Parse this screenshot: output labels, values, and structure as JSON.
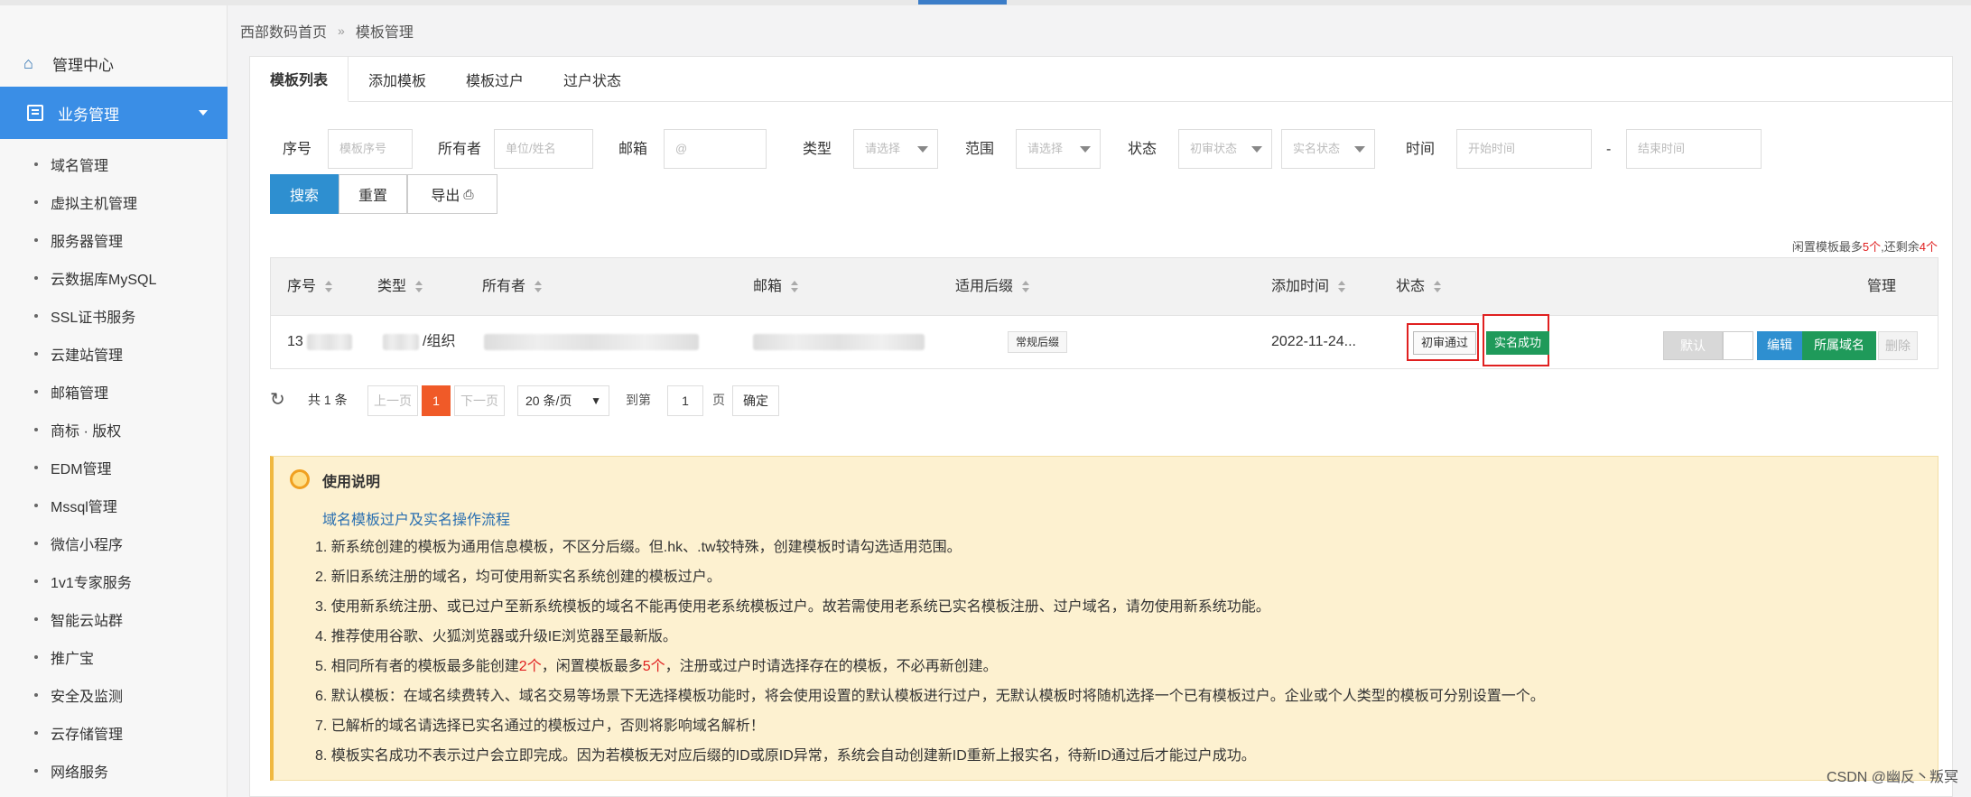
{
  "breadcrumb": {
    "home": "西部数码首页",
    "sep": "»",
    "current": "模板管理"
  },
  "sidebar": {
    "home": "管理中心",
    "active": "业务管理",
    "items": [
      "域名管理",
      "虚拟主机管理",
      "服务器管理",
      "云数据库MySQL",
      "SSL证书服务",
      "云建站管理",
      "邮箱管理",
      "商标 · 版权",
      "EDM管理",
      "Mssql管理",
      "微信小程序",
      "1v1专家服务",
      "智能云站群",
      "推广宝",
      "安全及监测",
      "云存储管理",
      "网络服务"
    ]
  },
  "tabs": [
    "模板列表",
    "添加模板",
    "模板过户",
    "过户状态"
  ],
  "filters": {
    "id_label": "序号",
    "id_placeholder": "模板序号",
    "owner_label": "所有者",
    "owner_placeholder": "单位/姓名",
    "email_label": "邮箱",
    "email_placeholder": "@",
    "type_label": "类型",
    "type_value": "请选择",
    "scope_label": "范围",
    "scope_value": "请选择",
    "status_label": "状态",
    "status_value1": "初审状态",
    "status_value2": "实名状态",
    "time_label": "时间",
    "time_start": "开始时间",
    "time_dash": "-",
    "time_end": "结束时间"
  },
  "buttons": {
    "search": "搜索",
    "reset": "重置",
    "export": "导出"
  },
  "idle_note": {
    "prefix": "闲置模板最多",
    "max": "5个",
    "mid": ",还剩余",
    "left": "4个"
  },
  "table": {
    "headers": [
      "序号",
      "类型",
      "所有者",
      "邮箱",
      "适用后缀",
      "添加时间",
      "状态",
      "管理"
    ],
    "row": {
      "id": "13",
      "type": "/组织",
      "suffix": "常规后缀",
      "added": "2022-11-24...",
      "status1": "初审通过",
      "status2": "实名成功",
      "default_btn": "默认",
      "edit_btn": "编辑",
      "domain_btn": "所属域名",
      "delete_btn": "删除"
    }
  },
  "pager": {
    "total": "共 1 条",
    "prev": "上一页",
    "current": "1",
    "next": "下一页",
    "per_page": "20 条/页",
    "goto": "到第",
    "goto_value": "1",
    "page_unit": "页",
    "confirm": "确定"
  },
  "usage": {
    "title": "使用说明",
    "link": "域名模板过户及实名操作流程",
    "lines": [
      "1. 新系统创建的模板为通用信息模板，不区分后缀。但.hk、.tw较特殊，创建模板时请勾选适用范围。",
      "2. 新旧系统注册的域名，均可使用新实名系统创建的模板过户。",
      "3. 使用新系统注册、或已过户至新系统模板的域名不能再使用老系统模板过户。故若需使用老系统已实名模板注册、过户域名，请勿使用新系统功能。",
      "4. 推荐使用谷歌、火狐浏览器或升级IE浏览器至最新版。"
    ],
    "line5": {
      "a": "5. 相同所有者的模板最多能创建",
      "b": "2个",
      "c": "，闲置模板最多",
      "d": "5个",
      "e": "，注册或过户时请选择存在的模板，不必再新创建。"
    },
    "lines2": [
      "6. 默认模板：在域名续费转入、域名交易等场景下无选择模板功能时，将会使用设置的默认模板进行过户，无默认模板时将随机选择一个已有模板过户。企业或个人类型的模板可分别设置一个。",
      "7. 已解析的域名请选择已实名通过的模板过户，否则将影响域名解析！",
      "8. 模板实名成功不表示过户会立即完成。因为若模板无对应后缀的ID或原ID异常，系统会自动创建新ID重新上报实名，待新ID通过后才能过户成功。"
    ]
  },
  "watermark": "CSDN @幽反丶叛冥"
}
